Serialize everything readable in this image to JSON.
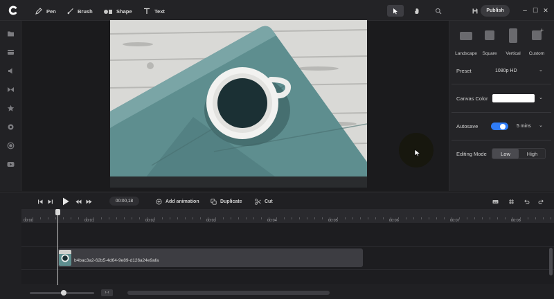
{
  "toolbar": {
    "tools": [
      {
        "label": "Pen",
        "icon": "pen-icon"
      },
      {
        "label": "Brush",
        "icon": "brush-icon"
      },
      {
        "label": "Shape",
        "icon": "shape-icon"
      },
      {
        "label": "Text",
        "icon": "text-icon"
      }
    ],
    "publish_label": "Publish",
    "window_controls": [
      "–",
      "☐",
      "✕"
    ]
  },
  "panel": {
    "aspect_options": [
      {
        "label": "Landscape"
      },
      {
        "label": "Square"
      },
      {
        "label": "Vertical"
      },
      {
        "label": "Custom"
      }
    ],
    "preset_label": "Preset",
    "preset_value": "1080p HD",
    "canvas_color_label": "Canvas Color",
    "canvas_color_value": "#ffffff",
    "autosave_label": "Autosave",
    "autosave_on": true,
    "autosave_interval": "5 mins",
    "editing_mode_label": "Editing Mode",
    "editing_mode_options": [
      "Low",
      "High"
    ],
    "editing_mode_selected": "Low"
  },
  "timeline": {
    "timecode": "00:00,18",
    "actions": [
      {
        "label": "Add animation",
        "icon": "add-animation-icon"
      },
      {
        "label": "Duplicate",
        "icon": "duplicate-icon"
      },
      {
        "label": "Cut",
        "icon": "scissors-icon"
      }
    ],
    "ruler_labels": [
      "00:00",
      "00:01",
      "00:02",
      "00:03",
      "00:04",
      "00:05",
      "00:06",
      "00:07",
      "00:08"
    ],
    "clip_name": "b4bac3a2-62b5-4d64-9e89-d126a24e9afa",
    "fit_label": "› ‹"
  },
  "colors": {
    "accent": "#2f7cf6",
    "background": "#1e1e20",
    "panel": "#242427"
  }
}
